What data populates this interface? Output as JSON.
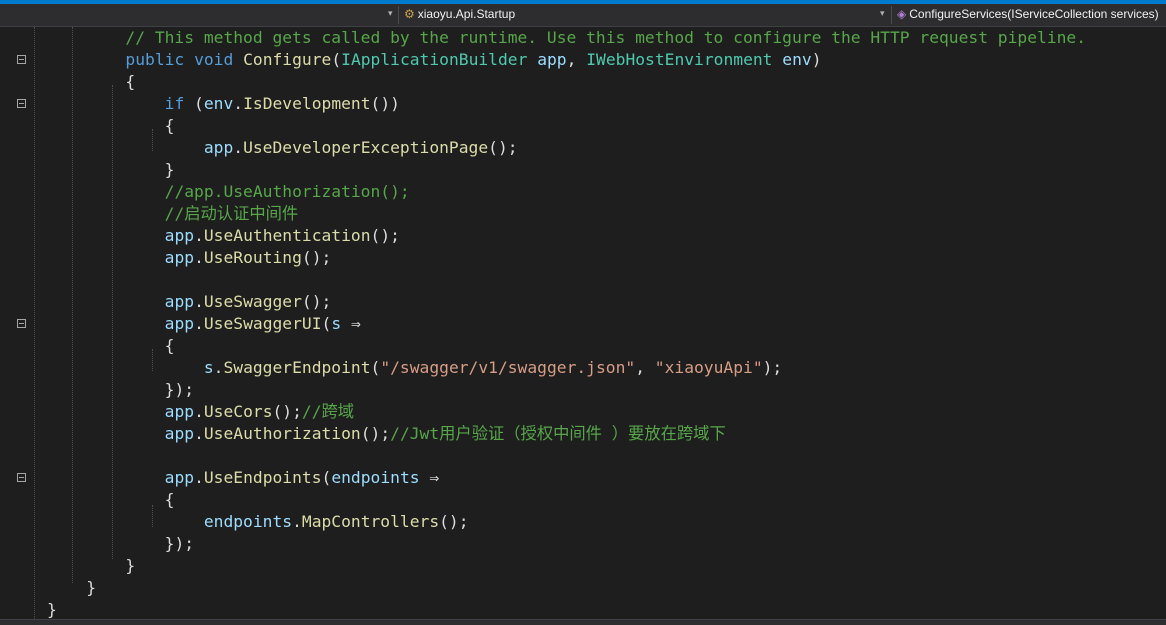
{
  "navbar": {
    "type_label": "xiaoyu.Api.Startup",
    "member_label": "ConfigureServices(IServiceCollection services)",
    "type_icon": "class-icon",
    "member_icon": "method-icon"
  },
  "colors": {
    "keyword": "#569cd6",
    "type": "#4ec9b0",
    "method": "#dcdcaa",
    "parameter": "#9cdcfe",
    "string": "#d69d85",
    "comment": "#57a64a",
    "text": "#dcdcdc",
    "background": "#1e1e1e"
  },
  "code": [
    {
      "ind": "        ",
      "fold": false,
      "t": [
        [
          "c",
          "// This method gets called by the runtime. Use this method to configure the HTTP request pipeline."
        ]
      ]
    },
    {
      "ind": "        ",
      "fold": true,
      "t": [
        [
          "k",
          "public"
        ],
        [
          "",
          " "
        ],
        [
          "k",
          "void"
        ],
        [
          "",
          " "
        ],
        [
          "m",
          "Configure"
        ],
        [
          "",
          "("
        ],
        [
          "cl",
          "IApplicationBuilder"
        ],
        [
          "",
          " "
        ],
        [
          "p",
          "app"
        ],
        [
          "",
          ", "
        ],
        [
          "cl",
          "IWebHostEnvironment"
        ],
        [
          "",
          " "
        ],
        [
          "p",
          "env"
        ],
        [
          "",
          ")"
        ]
      ]
    },
    {
      "ind": "        ",
      "fold": false,
      "t": [
        [
          "",
          "{"
        ]
      ]
    },
    {
      "ind": "            ",
      "fold": true,
      "t": [
        [
          "k",
          "if"
        ],
        [
          "",
          " ("
        ],
        [
          "p",
          "env"
        ],
        [
          "",
          "."
        ],
        [
          "m",
          "IsDevelopment"
        ],
        [
          "",
          "())"
        ]
      ]
    },
    {
      "ind": "            ",
      "fold": false,
      "t": [
        [
          "",
          "{"
        ]
      ]
    },
    {
      "ind": "                ",
      "fold": false,
      "t": [
        [
          "p",
          "app"
        ],
        [
          "",
          "."
        ],
        [
          "m",
          "UseDeveloperExceptionPage"
        ],
        [
          "",
          "();"
        ]
      ]
    },
    {
      "ind": "            ",
      "fold": false,
      "t": [
        [
          "",
          "}"
        ]
      ]
    },
    {
      "ind": "            ",
      "fold": false,
      "t": [
        [
          "c",
          "//app.UseAuthorization();"
        ]
      ]
    },
    {
      "ind": "            ",
      "fold": false,
      "t": [
        [
          "c",
          "//启动认证中间件"
        ]
      ]
    },
    {
      "ind": "            ",
      "fold": false,
      "t": [
        [
          "p",
          "app"
        ],
        [
          "",
          "."
        ],
        [
          "m",
          "UseAuthentication"
        ],
        [
          "",
          "();"
        ]
      ]
    },
    {
      "ind": "            ",
      "fold": false,
      "t": [
        [
          "p",
          "app"
        ],
        [
          "",
          "."
        ],
        [
          "m",
          "UseRouting"
        ],
        [
          "",
          "();"
        ]
      ]
    },
    {
      "ind": "",
      "fold": false,
      "t": []
    },
    {
      "ind": "            ",
      "fold": false,
      "t": [
        [
          "p",
          "app"
        ],
        [
          "",
          "."
        ],
        [
          "m",
          "UseSwagger"
        ],
        [
          "",
          "();"
        ]
      ]
    },
    {
      "ind": "            ",
      "fold": true,
      "t": [
        [
          "p",
          "app"
        ],
        [
          "",
          "."
        ],
        [
          "m",
          "UseSwaggerUI"
        ],
        [
          "",
          "("
        ],
        [
          "p",
          "s"
        ],
        [
          "",
          " ⇒"
        ]
      ]
    },
    {
      "ind": "            ",
      "fold": false,
      "t": [
        [
          "",
          "{"
        ]
      ]
    },
    {
      "ind": "                ",
      "fold": false,
      "t": [
        [
          "p",
          "s"
        ],
        [
          "",
          "."
        ],
        [
          "m",
          "SwaggerEndpoint"
        ],
        [
          "",
          "("
        ],
        [
          "s",
          "\"/swagger/v1/swagger.json\""
        ],
        [
          "",
          ", "
        ],
        [
          "s",
          "\"xiaoyuApi\""
        ],
        [
          "",
          ");"
        ]
      ]
    },
    {
      "ind": "            ",
      "fold": false,
      "t": [
        [
          "",
          "});"
        ]
      ]
    },
    {
      "ind": "            ",
      "fold": false,
      "t": [
        [
          "p",
          "app"
        ],
        [
          "",
          "."
        ],
        [
          "m",
          "UseCors"
        ],
        [
          "",
          "();"
        ],
        [
          "c",
          "//跨域"
        ]
      ]
    },
    {
      "ind": "            ",
      "fold": false,
      "t": [
        [
          "p",
          "app"
        ],
        [
          "",
          "."
        ],
        [
          "m",
          "UseAuthorization"
        ],
        [
          "",
          "();"
        ],
        [
          "c",
          "//Jwt用户验证（授权中间件 ）要放在跨域下"
        ]
      ]
    },
    {
      "ind": "",
      "fold": false,
      "t": []
    },
    {
      "ind": "            ",
      "fold": true,
      "t": [
        [
          "p",
          "app"
        ],
        [
          "",
          "."
        ],
        [
          "m",
          "UseEndpoints"
        ],
        [
          "",
          "("
        ],
        [
          "p",
          "endpoints"
        ],
        [
          "",
          " ⇒"
        ]
      ]
    },
    {
      "ind": "            ",
      "fold": false,
      "t": [
        [
          "",
          "{"
        ]
      ]
    },
    {
      "ind": "                ",
      "fold": false,
      "t": [
        [
          "p",
          "endpoints"
        ],
        [
          "",
          "."
        ],
        [
          "m",
          "MapControllers"
        ],
        [
          "",
          "();"
        ]
      ]
    },
    {
      "ind": "            ",
      "fold": false,
      "t": [
        [
          "",
          "});"
        ]
      ]
    },
    {
      "ind": "        ",
      "fold": false,
      "t": [
        [
          "",
          "}"
        ]
      ]
    },
    {
      "ind": "    ",
      "fold": false,
      "t": [
        [
          "",
          "}"
        ]
      ]
    },
    {
      "ind": "",
      "fold": false,
      "t": [
        [
          "",
          "}"
        ]
      ]
    }
  ]
}
